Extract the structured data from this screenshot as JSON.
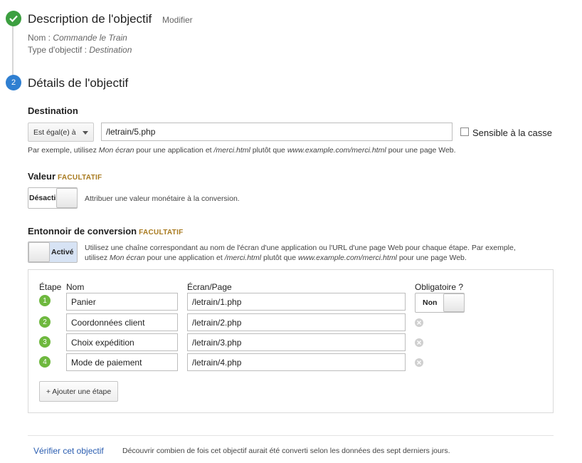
{
  "step1": {
    "title": "Description de l'objectif",
    "modify_label": "Modifier",
    "name_label": "Nom : ",
    "name_value": "Commande le Train",
    "type_label": "Type d'objectif : ",
    "type_value": "Destination"
  },
  "step2": {
    "number": "2",
    "title": "Détails de l'objectif"
  },
  "destination": {
    "label": "Destination",
    "match_type": "Est égal(e) à",
    "value": "/letrain/5.php",
    "case_sensitive_label": "Sensible à la casse",
    "case_sensitive_checked": false,
    "hint_pre": "Par exemple, utilisez ",
    "hint_em1": "Mon écran",
    "hint_mid1": " pour une application et ",
    "hint_em2": "/merci.html",
    "hint_mid2": " plutôt que ",
    "hint_em3": "www.example.com/merci.html",
    "hint_post": " pour une page Web."
  },
  "value": {
    "label": "Valeur",
    "optional": "FACULTATIF",
    "toggle_label": "Désacti",
    "description": "Attribuer une valeur monétaire à la conversion."
  },
  "funnel": {
    "label": "Entonnoir de conversion",
    "optional": "FACULTATIF",
    "toggle_label": "Activé",
    "desc_line1": "Utilisez une chaîne correspondant au nom de l'écran d'une application ou l'URL d'une page Web pour chaque étape. Par exemple,",
    "desc_l2_pre": "utilisez ",
    "desc_l2_em1": "Mon écran",
    "desc_l2_mid1": " pour une application et ",
    "desc_l2_em2": "/merci.html",
    "desc_l2_mid2": " plutôt que ",
    "desc_l2_em3": "www.example.com/merci.html",
    "desc_l2_post": " pour une page Web.",
    "col_step": "Étape",
    "col_name": "Nom",
    "col_screen": "Écran/Page",
    "col_required": "Obligatoire ?",
    "required_toggle": "Non",
    "steps": [
      {
        "num": "1",
        "name": "Panier",
        "page": "/letrain/1.php"
      },
      {
        "num": "2",
        "name": "Coordonnées client",
        "page": "/letrain/2.php"
      },
      {
        "num": "3",
        "name": "Choix expédition",
        "page": "/letrain/3.php"
      },
      {
        "num": "4",
        "name": "Mode de paiement",
        "page": "/letrain/4.php"
      }
    ],
    "add_step_label": "+ Ajouter une étape"
  },
  "footer": {
    "verify_label": "Vérifier cet objectif",
    "verify_desc": "Découvrir combien de fois cet objectif aurait été converti selon les données des sept derniers jours."
  },
  "colors": {
    "check": "#3c9f40",
    "step_number": "#2f7fd1",
    "optional": "#a87a1f",
    "funnel_badge": "#6eb83e",
    "link": "#2a5db0"
  }
}
